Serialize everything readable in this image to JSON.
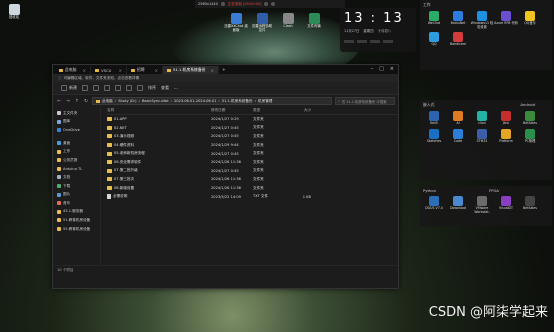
{
  "topbar": {
    "resolution": "2560x1440",
    "recording": "正在录制 [00:00:00]"
  },
  "desktop": {
    "recycle_bin": "回收站",
    "icons": [
      "迅雷XXChat 桌面版",
      "迅雷远程协助 控件",
      "Clash",
      "文件传输"
    ]
  },
  "clock": {
    "time": "13 : 13",
    "date": "11月27日",
    "weekday": "星期四",
    "lunar": "十月初八"
  },
  "panels": {
    "tools": {
      "title": "工作",
      "items": [
        "WeChat",
        "BaiduNet",
        "Windows11 轻松设置",
        "Azure RFB 代码",
        "QQ音乐",
        "QQ",
        "Bandicam"
      ]
    },
    "ai": {
      "title": "嵌入式",
      "sub": "Android",
      "items": [
        "Keil5",
        "AI",
        "clion",
        "Jlink",
        "BetSales",
        "Sketches",
        "Code",
        "STM32",
        "Platform",
        "PC管理",
        "Visual Studio"
      ]
    },
    "prog": {
      "title": "Python",
      "sub": "FPGA",
      "items": [
        "DGUS V7.4",
        "Download",
        "VMware Workstat.",
        "VisualDT",
        "BetSales"
      ]
    }
  },
  "explorer": {
    "tabs": [
      {
        "label": "此电脑",
        "active": false
      },
      {
        "label": "VSCX",
        "active": false
      },
      {
        "label": "招聘",
        "active": false
      },
      {
        "label": "51.1.机房系统备份",
        "active": true
      }
    ],
    "info_bar": "可编辑区域。软件、文件夹未知、点击查看详情",
    "toolbar": {
      "new": "新建",
      "sort": "排序",
      "view": "查看",
      "more": "···"
    },
    "address": [
      "此电脑",
      "Study (D:)",
      "BasicSync.disk",
      "2023.06.01-2024.06.01",
      "51.1.机房系统备份",
      "机房管理"
    ],
    "search_placeholder": "在 51.1.机房系统备份 中搜索",
    "sidebar": [
      {
        "label": "主文件夹",
        "color": "#c8c8c8"
      },
      {
        "label": "图库",
        "color": "#7aa7d8"
      },
      {
        "label": "OneDrive",
        "color": "#3b82d6"
      },
      {
        "label": "桌面",
        "color": "#4f9be0"
      },
      {
        "label": "工作",
        "color": "#e8be50"
      },
      {
        "label": "公务员报",
        "color": "#e8be50"
      },
      {
        "label": "Arduino TL",
        "color": "#e8be50"
      },
      {
        "label": "文档",
        "color": "#9fb3c8"
      },
      {
        "label": "下载",
        "color": "#4fae6f"
      },
      {
        "label": "图片",
        "color": "#5b9bd5"
      },
      {
        "label": "音乐",
        "color": "#e06c5a"
      },
      {
        "label": "43.1.服务器",
        "color": "#e8be50"
      },
      {
        "label": "51.教育机房设备",
        "color": "#e8be50"
      },
      {
        "label": "55.教育机房设备",
        "color": "#e8be50"
      }
    ],
    "columns": [
      "名称",
      "修改日期",
      "类型",
      "大小"
    ],
    "rows": [
      {
        "name": "01.APP",
        "date": "2024/1/27 0:29",
        "type": "文件夹",
        "size": "",
        "kind": "folder"
      },
      {
        "name": "02.NET",
        "date": "2024/1/27 0:45",
        "type": "文件夹",
        "size": "",
        "kind": "folder"
      },
      {
        "name": "03.演示视频",
        "date": "2024/1/27 0:45",
        "type": "文件夹",
        "size": "",
        "kind": "folder"
      },
      {
        "name": "04.硬件资料",
        "date": "2024/1/29 9:44",
        "type": "文件夹",
        "size": "",
        "kind": "folder"
      },
      {
        "name": "05.老师新机房流程",
        "date": "2024/1/27 0:45",
        "type": "文件夹",
        "size": "",
        "kind": "folder"
      },
      {
        "name": "06.安全需求软件",
        "date": "2024/1/26 11:36",
        "type": "文件夹",
        "size": "",
        "kind": "folder"
      },
      {
        "name": "07.第二批升级",
        "date": "2024/1/27 0:45",
        "type": "文件夹",
        "size": "",
        "kind": "folder"
      },
      {
        "name": "07.第三批次",
        "date": "2024/1/26 11:36",
        "type": "文件夹",
        "size": "",
        "kind": "folder"
      },
      {
        "name": "08.新增设置",
        "date": "2024/1/26 11:36",
        "type": "文件夹",
        "size": "",
        "kind": "folder"
      },
      {
        "name": "必需说明",
        "date": "2023/5/22 14:09",
        "type": "TXT 文件",
        "size": "1 KB",
        "kind": "file"
      }
    ],
    "status": "10 个项目"
  },
  "watermark": "CSDN @阿柒学起来"
}
